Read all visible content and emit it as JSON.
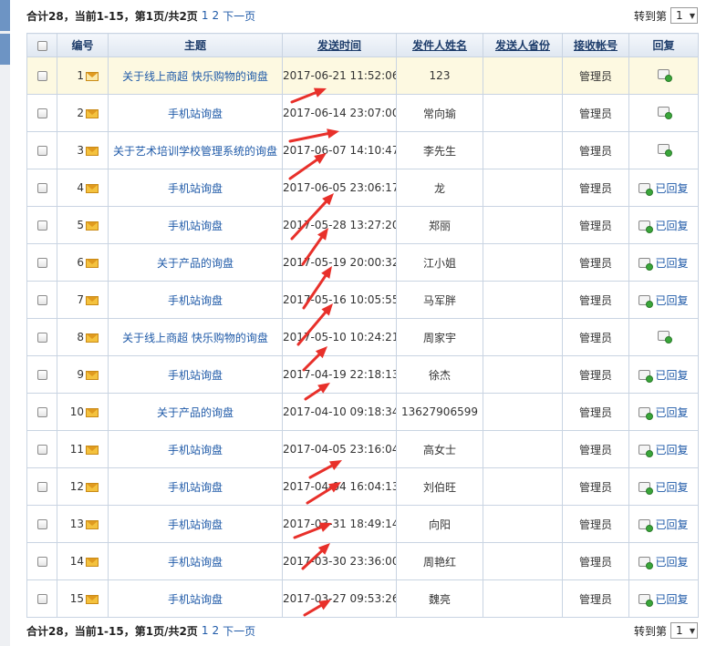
{
  "pager": {
    "summary": "合计28，当前1-15，第1页/共2页",
    "page1": "1",
    "page2": "2",
    "next": "下一页",
    "goto_label": "转到第",
    "goto_value": "1"
  },
  "columns": {
    "id": "编号",
    "subject": "主题",
    "send_time": "发送时间",
    "sender_name": "发件人姓名",
    "sender_province": "发送人省份",
    "receiver": "接收帐号",
    "reply": "回复"
  },
  "reply_label": "已回复",
  "rows": [
    {
      "id": "1",
      "subject": "关于线上商超 快乐购物的询盘",
      "time": "2017-06-21 11:52:06",
      "name": "123",
      "province": "",
      "receiver": "管理员",
      "replied": false,
      "opened": true,
      "highlight": true
    },
    {
      "id": "2",
      "subject": "手机站询盘",
      "time": "2017-06-14 23:07:00",
      "name": "常向瑜",
      "province": "",
      "receiver": "管理员",
      "replied": false,
      "opened": false,
      "highlight": false
    },
    {
      "id": "3",
      "subject": "关于艺术培训学校管理系统的询盘",
      "time": "2017-06-07 14:10:47",
      "name": "李先生",
      "province": "",
      "receiver": "管理员",
      "replied": false,
      "opened": false,
      "highlight": false
    },
    {
      "id": "4",
      "subject": "手机站询盘",
      "time": "2017-06-05 23:06:17",
      "name": "龙",
      "province": "",
      "receiver": "管理员",
      "replied": true,
      "opened": false,
      "highlight": false
    },
    {
      "id": "5",
      "subject": "手机站询盘",
      "time": "2017-05-28 13:27:20",
      "name": "郑丽",
      "province": "",
      "receiver": "管理员",
      "replied": true,
      "opened": false,
      "highlight": false
    },
    {
      "id": "6",
      "subject": "关于产品的询盘",
      "time": "2017-05-19 20:00:32",
      "name": "江小姐",
      "province": "",
      "receiver": "管理员",
      "replied": true,
      "opened": false,
      "highlight": false
    },
    {
      "id": "7",
      "subject": "手机站询盘",
      "time": "2017-05-16 10:05:55",
      "name": "马军胖",
      "province": "",
      "receiver": "管理员",
      "replied": true,
      "opened": false,
      "highlight": false
    },
    {
      "id": "8",
      "subject": "关于线上商超 快乐购物的询盘",
      "time": "2017-05-10 10:24:21",
      "name": "周家宇",
      "province": "",
      "receiver": "管理员",
      "replied": false,
      "opened": false,
      "highlight": false
    },
    {
      "id": "9",
      "subject": "手机站询盘",
      "time": "2017-04-19 22:18:13",
      "name": "徐杰",
      "province": "",
      "receiver": "管理员",
      "replied": true,
      "opened": false,
      "highlight": false
    },
    {
      "id": "10",
      "subject": "关于产品的询盘",
      "time": "2017-04-10 09:18:34",
      "name": "13627906599",
      "province": "",
      "receiver": "管理员",
      "replied": true,
      "opened": false,
      "highlight": false
    },
    {
      "id": "11",
      "subject": "手机站询盘",
      "time": "2017-04-05 23:16:04",
      "name": "高女士",
      "province": "",
      "receiver": "管理员",
      "replied": true,
      "opened": false,
      "highlight": false
    },
    {
      "id": "12",
      "subject": "手机站询盘",
      "time": "2017-04-04 16:04:13",
      "name": "刘伯旺",
      "province": "",
      "receiver": "管理员",
      "replied": true,
      "opened": false,
      "highlight": false
    },
    {
      "id": "13",
      "subject": "手机站询盘",
      "time": "2017-03-31 18:49:14",
      "name": "向阳",
      "province": "",
      "receiver": "管理员",
      "replied": true,
      "opened": false,
      "highlight": false
    },
    {
      "id": "14",
      "subject": "手机站询盘",
      "time": "2017-03-30 23:36:00",
      "name": "周艳红",
      "province": "",
      "receiver": "管理员",
      "replied": true,
      "opened": false,
      "highlight": false
    },
    {
      "id": "15",
      "subject": "手机站询盘",
      "time": "2017-03-27 09:53:26",
      "name": "魏亮",
      "province": "",
      "receiver": "管理员",
      "replied": true,
      "opened": false,
      "highlight": false
    }
  ],
  "colors": {
    "link": "#1f5aa8",
    "header_text": "#1e3d6b",
    "highlight_row": "#fdf9e1",
    "annotation_arrow": "#e8302a",
    "left_tab": "#6d94c4"
  },
  "icons": {
    "message": "envelope-icon",
    "reply": "reply-icon",
    "dropdown": "chevron-down-icon"
  }
}
